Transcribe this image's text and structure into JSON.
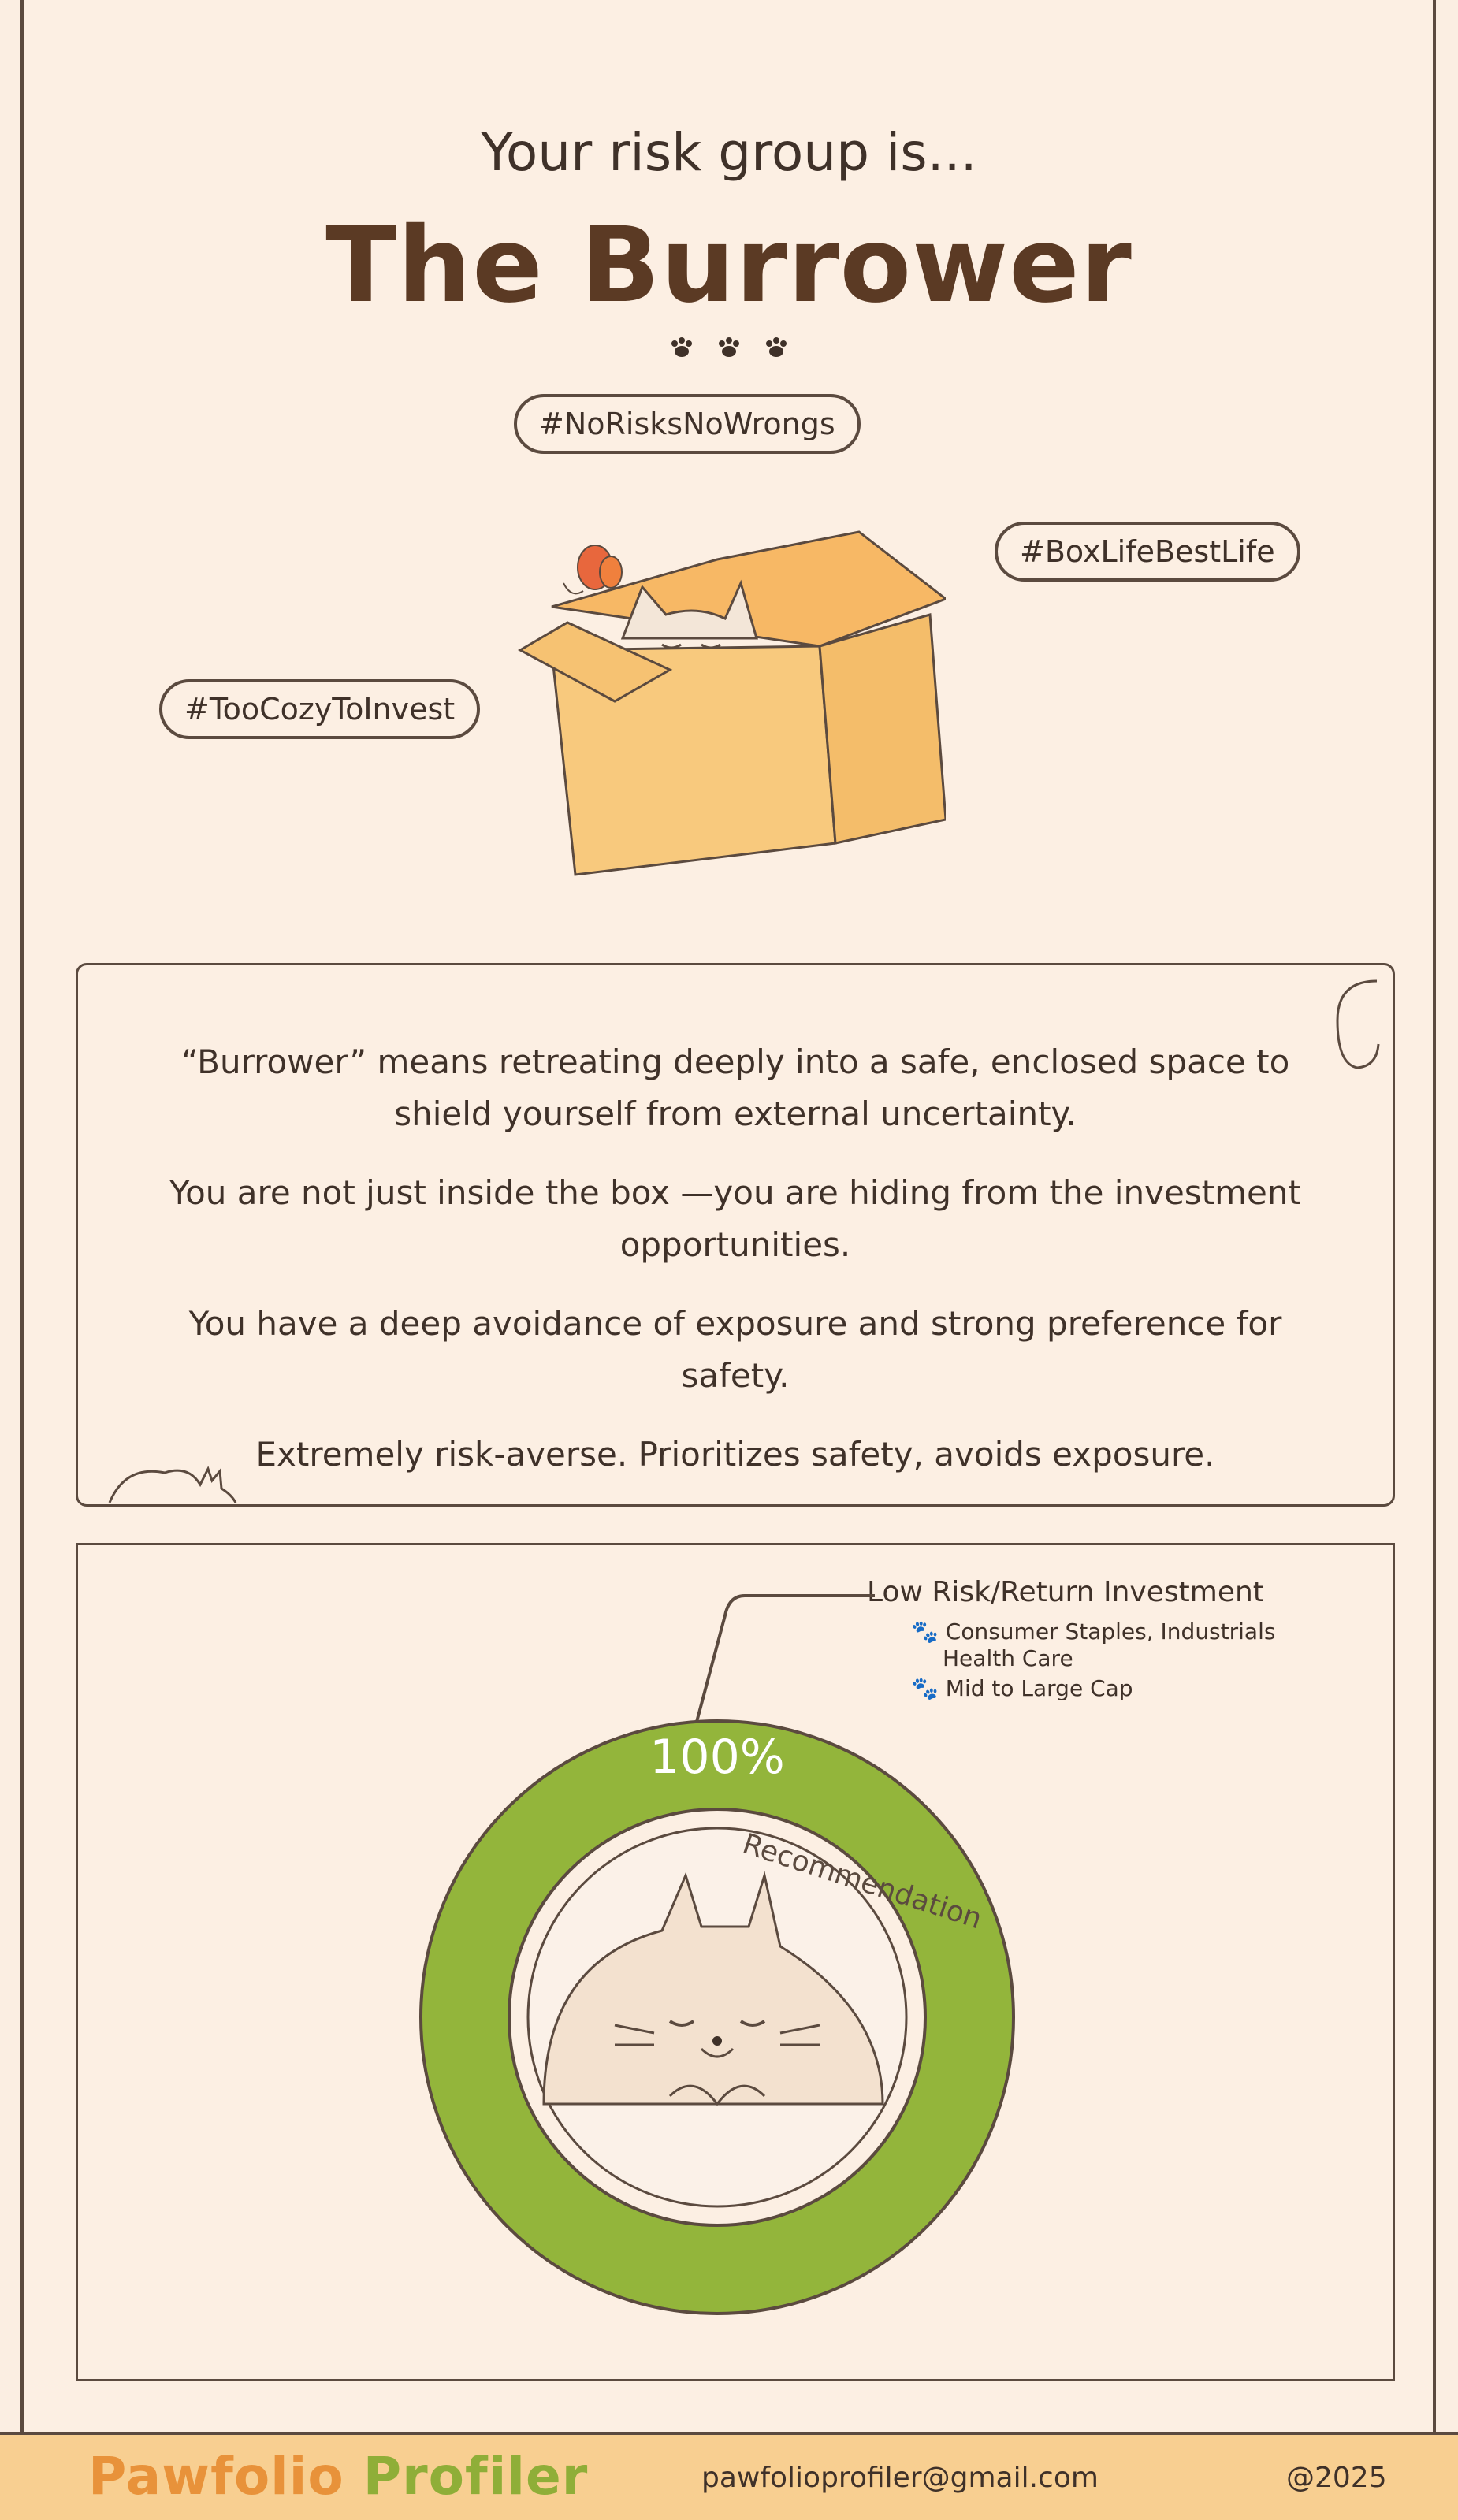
{
  "header": {
    "pretitle": "Your risk group is...",
    "title": "The Burrower"
  },
  "tags": [
    "#NoRisksNoWrongs",
    "#BoxLifeBestLife",
    "#TooCozyToInvest"
  ],
  "description": [
    "“Burrower” means retreating deeply into a safe, enclosed space to shield yourself from external uncertainty.",
    "You are not just inside the box —you are hiding from the investment opportunities.",
    "You have a deep avoidance of exposure and strong preference for safety.",
    "Extremely risk-averse. Prioritizes safety, avoids exposure."
  ],
  "recommendation": {
    "title": "Low Risk/Return Investment",
    "items": [
      "Consumer Staples, Industrials",
      "Health Care",
      "Mid to Large Cap"
    ],
    "percent_label": "100%",
    "percent": 100,
    "ring_label": "Recommendation",
    "ring_color": "#93b53b"
  },
  "footer": {
    "logo_part1": "Pawfolio",
    "logo_part2": "Profiler",
    "email": "pawfolioprofiler@gmail.com",
    "copyright": "@2025"
  }
}
